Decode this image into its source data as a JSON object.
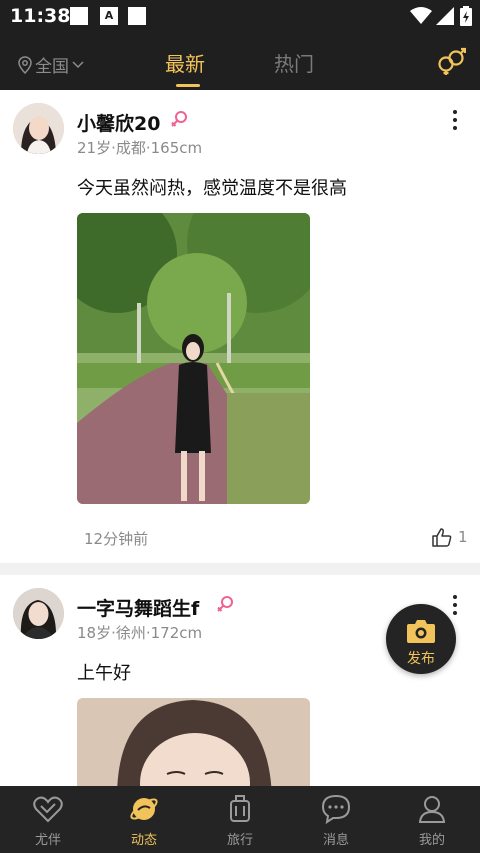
{
  "status_bar": {
    "time": "11:38",
    "icons": [
      "square-icon",
      "a-icon",
      "square-icon",
      "wifi-icon",
      "signal-icon",
      "battery-icon"
    ]
  },
  "top_nav": {
    "location": "全国",
    "tabs": [
      {
        "label": "最新",
        "active": true
      },
      {
        "label": "热门",
        "active": false
      }
    ],
    "right_icon": "gender-icon"
  },
  "posts": [
    {
      "username": "小馨欣20",
      "meta": "21岁·成都·165cm",
      "text": "今天虽然闷热，感觉温度不是很高",
      "time_ago": "12分钟前",
      "likes": "1"
    },
    {
      "username": "一字马舞蹈生f",
      "meta": "18岁·徐州·172cm",
      "text": "上午好"
    }
  ],
  "fab": {
    "label": "发布",
    "icon": "camera-icon"
  },
  "bottom_nav": [
    {
      "label": "尤伴",
      "icon": "heart-icon",
      "active": false
    },
    {
      "label": "动态",
      "icon": "planet-icon",
      "active": true
    },
    {
      "label": "旅行",
      "icon": "luggage-icon",
      "active": false
    },
    {
      "label": "消息",
      "icon": "chat-icon",
      "active": false
    },
    {
      "label": "我的",
      "icon": "person-icon",
      "active": false
    }
  ],
  "colors": {
    "accent": "#f2c35b",
    "dark": "#1f1f1f",
    "female": "#f06292",
    "muted": "#8a8a8a"
  }
}
